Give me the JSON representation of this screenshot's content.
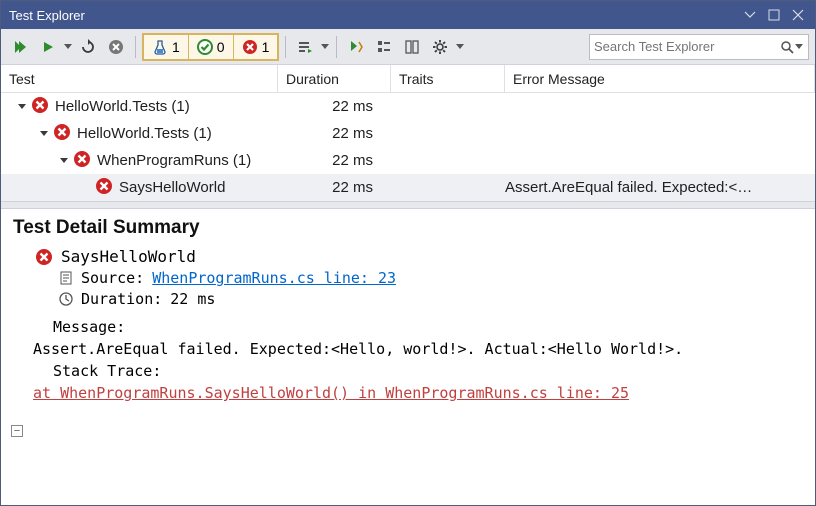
{
  "window": {
    "title": "Test Explorer"
  },
  "counters": {
    "total": "1",
    "passed": "0",
    "failed": "1"
  },
  "search": {
    "placeholder": "Search Test Explorer"
  },
  "columns": {
    "test": "Test",
    "duration": "Duration",
    "traits": "Traits",
    "error": "Error Message"
  },
  "tree": [
    {
      "indent": 14,
      "expander": true,
      "name": "HelloWorld.Tests (1)",
      "duration": "22 ms",
      "error": ""
    },
    {
      "indent": 36,
      "expander": true,
      "name": "HelloWorld.Tests (1)",
      "duration": "22 ms",
      "error": ""
    },
    {
      "indent": 56,
      "expander": true,
      "name": "WhenProgramRuns (1)",
      "duration": "22 ms",
      "error": ""
    },
    {
      "indent": 78,
      "expander": false,
      "name": "SaysHelloWorld",
      "duration": "22 ms",
      "error": "Assert.AreEqual failed. Expected:<…",
      "selected": true
    }
  ],
  "detail": {
    "heading": "Test Detail Summary",
    "test_name": "SaysHelloWorld",
    "source_label": "Source:",
    "source_link": "WhenProgramRuns.cs line: 23",
    "duration_label": "Duration:",
    "duration_value": "22 ms",
    "message_label": "Message:",
    "message_text": "Assert.AreEqual failed. Expected:<Hello, world!>. Actual:<Hello World!>.",
    "stack_label": "Stack Trace:",
    "stack_line": "at WhenProgramRuns.SaysHelloWorld() in WhenProgramRuns.cs line: 25"
  }
}
